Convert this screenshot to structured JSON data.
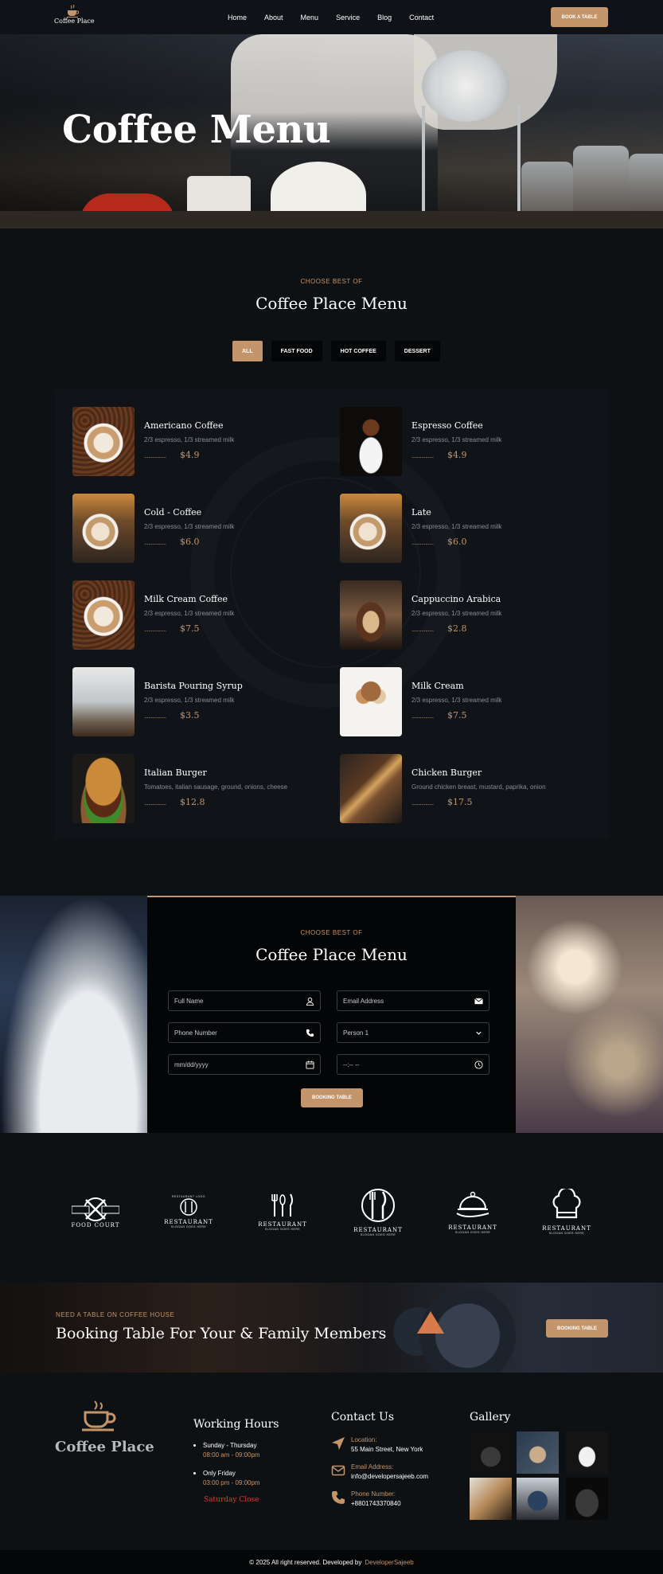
{
  "nav": {
    "logo_text": "Coffee Place",
    "links": [
      "Home",
      "About",
      "Menu",
      "Service",
      "Blog",
      "Contact"
    ],
    "book_button": "BOOK A TABLE"
  },
  "hero": {
    "title": "Coffee Menu"
  },
  "menu_section": {
    "subtitle": "CHOOSE BEST OF",
    "title": "Coffee Place Menu",
    "filters": [
      "ALL",
      "FAST FOOD",
      "HOT COFFEE",
      "DESSERT"
    ],
    "active_filter": "ALL",
    "items": [
      {
        "name": "Americano Coffee",
        "desc": "2/3 espresso, 1/3 streamed milk",
        "price": "$4.9"
      },
      {
        "name": "Espresso Coffee",
        "desc": "2/3 espresso, 1/3 streamed milk",
        "price": "$4.9"
      },
      {
        "name": "Cold - Coffee",
        "desc": "2/3 espresso, 1/3 streamed milk",
        "price": "$6.0"
      },
      {
        "name": "Late",
        "desc": "2/3 espresso, 1/3 streamed milk",
        "price": "$6.0"
      },
      {
        "name": "Milk Cream Coffee",
        "desc": "2/3 espresso, 1/3 streamed milk",
        "price": "$7.5"
      },
      {
        "name": "Cappuccino Arabica",
        "desc": "2/3 espresso, 1/3 streamed milk",
        "price": "$2.8"
      },
      {
        "name": "Barista Pouring Syrup",
        "desc": "2/3 espresso, 1/3 streamed milk",
        "price": "$3.5"
      },
      {
        "name": "Milk Cream",
        "desc": "2/3 espresso, 1/3 streamed milk",
        "price": "$7.5"
      },
      {
        "name": "Italian Burger",
        "desc": "Tomatoes, italian sausage, ground, onions, cheese",
        "price": "$12.8"
      },
      {
        "name": "Chicken Burger",
        "desc": "Ground chicken breast, mustard, paprika, onion",
        "price": "$17.5"
      }
    ],
    "dots": "................"
  },
  "booking": {
    "subtitle": "CHOOSE BEST OF",
    "title": "Coffee Place Menu",
    "full_name_placeholder": "Full Name",
    "email_placeholder": "Email Address",
    "phone_placeholder": "Phone Number",
    "person_value": "Person 1",
    "date_value": "mm/dd/yyyy",
    "time_value": "--:-- --",
    "button": "BOOKING TABLE"
  },
  "logos": [
    {
      "top": "",
      "main": "FOOD COURT",
      "sub": ""
    },
    {
      "top": "RESTAURANT LOGO",
      "main": "RESTAURANT",
      "sub": "SLOGAN GOES HERE"
    },
    {
      "top": "",
      "main": "RESTAURANT",
      "sub": "SLOGAN GOES HERE"
    },
    {
      "top": "",
      "main": "RESTAURANT",
      "sub": "SLOGAN GOES HERE"
    },
    {
      "top": "",
      "main": "RESTAURANT",
      "sub": "SLOGAN GOES HERE"
    },
    {
      "top": "",
      "main": "RESTAURANT",
      "sub": "SLOGAN GOES HERE"
    }
  ],
  "cta": {
    "subtitle": "NEED A TABLE ON COFFEE HOUSE",
    "title": "Booking Table For Your & Family Members",
    "button": "BOOKING TABLE"
  },
  "footer": {
    "logo_text": "Coffee Place",
    "working_hours_title": "Working Hours",
    "days1": "Sunday - Thursday",
    "time1": "08:00 am - 09:00pm",
    "days2": "Only Friday",
    "time2": "03:00 pm - 09:00pm",
    "closed": "Saturday Close",
    "contact_title": "Contact Us",
    "location_label": "Location:",
    "location_value": "55 Main Street, New York",
    "email_label": "Email Address:",
    "email_value": "info@developersajeeb.com",
    "phone_label": "Phone Number:",
    "phone_value": "+8801743370840",
    "gallery_title": "Gallery"
  },
  "copyright": {
    "text": "© 2025 All right reserved. Developed by",
    "developer": "DeveloperSajeeb"
  },
  "colors": {
    "accent": "#c4956a",
    "background": "#0e1114",
    "closed_red": "#e23b2e"
  }
}
